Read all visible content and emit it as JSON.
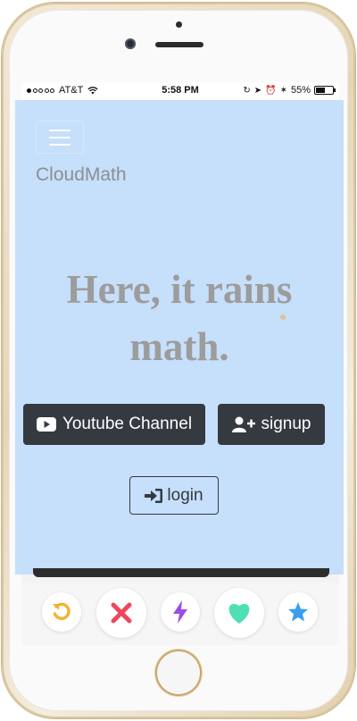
{
  "status_bar": {
    "carrier": "AT&T",
    "time": "5:58 PM",
    "battery": "55%",
    "battery_level": 0.55
  },
  "app": {
    "brand": "CloudMath",
    "hero_line1": "Here, it rains",
    "hero_line2": "math.",
    "youtube_button": "Youtube Channel",
    "signup_button": "signup",
    "login_button": "login",
    "colors": {
      "panel_background": "#c6dffa",
      "dark_button": "#343a40",
      "brand_text": "#8c8f93"
    }
  },
  "action_bar": {
    "icons": [
      "rewind-icon",
      "close-icon",
      "lightning-icon",
      "heart-icon",
      "star-icon"
    ],
    "colors": {
      "rewind": "#f2b230",
      "nope": "#f0465c",
      "boost": "#9a4ee6",
      "like": "#4ee0b2",
      "super": "#3b9ff0"
    }
  }
}
